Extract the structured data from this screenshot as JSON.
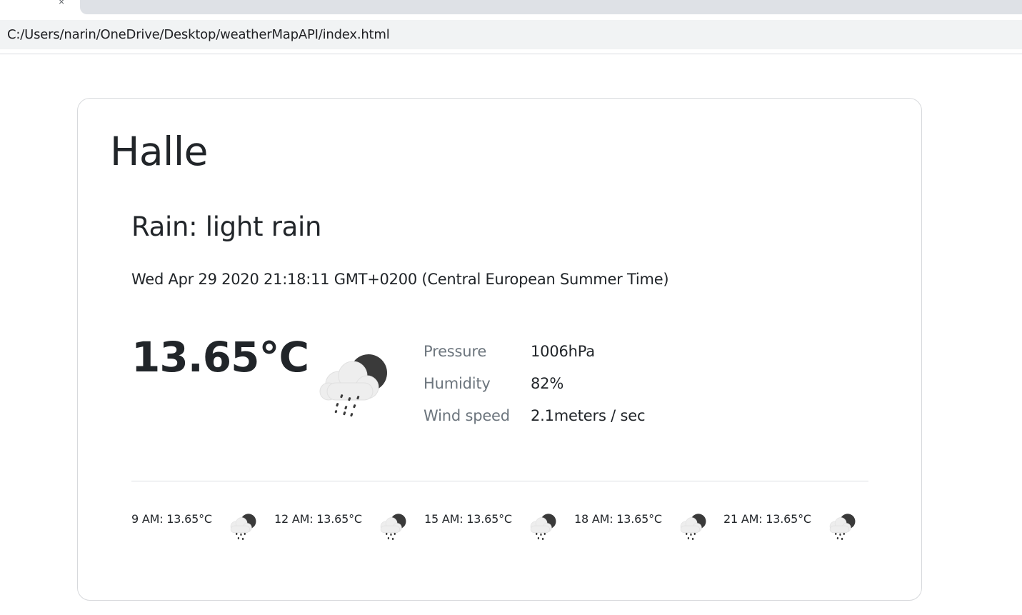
{
  "browser": {
    "url": "C:/Users/narin/OneDrive/Desktop/weatherMapAPI/index.html"
  },
  "weather": {
    "city": "Halle",
    "condition": "Rain: light rain",
    "datetime": "Wed Apr 29 2020 21:18:11 GMT+0200 (Central European Summer Time)",
    "temperature": "13.65°C",
    "icon": "rain-cloud-moon-icon",
    "details": [
      {
        "label": "Pressure",
        "value": "1006hPa"
      },
      {
        "label": "Humidity",
        "value": "82%"
      },
      {
        "label": "Wind speed",
        "value": "2.1meters / sec"
      }
    ],
    "forecast": [
      {
        "text": "9 AM: 13.65°C",
        "icon": "rain-cloud-moon-icon"
      },
      {
        "text": "12 AM: 13.65°C",
        "icon": "rain-cloud-moon-icon"
      },
      {
        "text": "15 AM: 13.65°C",
        "icon": "rain-cloud-moon-icon"
      },
      {
        "text": "18 AM: 13.65°C",
        "icon": "rain-cloud-moon-icon"
      },
      {
        "text": "21 AM: 13.65°C",
        "icon": "rain-cloud-moon-icon"
      }
    ]
  }
}
